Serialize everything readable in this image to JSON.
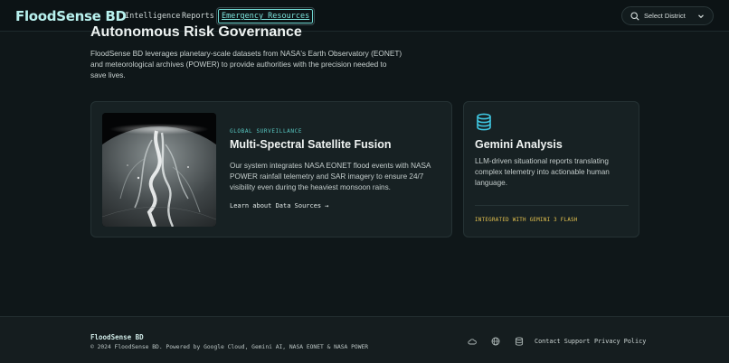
{
  "header": {
    "brand": "FloodSense BD",
    "nav": {
      "intelligence": "Intelligence",
      "reports": "Reports",
      "emergency": "Emergency Resources"
    },
    "district_select": {
      "label": "Select District",
      "icon": "search-icon",
      "chevron": "chevron-down-icon"
    }
  },
  "hero": {
    "title": "Autonomous Risk Governance",
    "text": "FloodSense BD leverages planetary-scale datasets from NASA's Earth Observatory (EONET) and meteorological archives (POWER) to provide authorities with the precision needed to save lives."
  },
  "cards": {
    "satellite": {
      "kicker": "GLOBAL SURVEILLANCE",
      "title": "Multi-Spectral Satellite Fusion",
      "description": "Our system integrates NASA EONET flood events with NASA POWER rainfall telemetry and SAR imagery to ensure 24/7 visibility even during the heaviest monsoon rains.",
      "link": "Learn about Data Sources",
      "link_arrow": "→"
    },
    "gemini": {
      "icon": "database-icon",
      "title": "Gemini Analysis",
      "description": "LLM-driven situational reports translating complex telemetry into actionable human language.",
      "integrated": "INTEGRATED WITH GEMINI 3 FLASH"
    }
  },
  "footer": {
    "brand": "FloodSense BD",
    "copyright": "© 2024 FloodSense BD. Powered by Google Cloud, Gemini AI, NASA EONET & NASA POWER",
    "icons": [
      "cloud-icon",
      "globe-icon",
      "database-icon"
    ],
    "links": {
      "contact": "Contact Support",
      "privacy": "Privacy Policy"
    }
  },
  "colors": {
    "background": "#0f1719",
    "accent": "#59c9c3",
    "brand": "#b8f1ee",
    "highlight": "#e7c44f"
  }
}
